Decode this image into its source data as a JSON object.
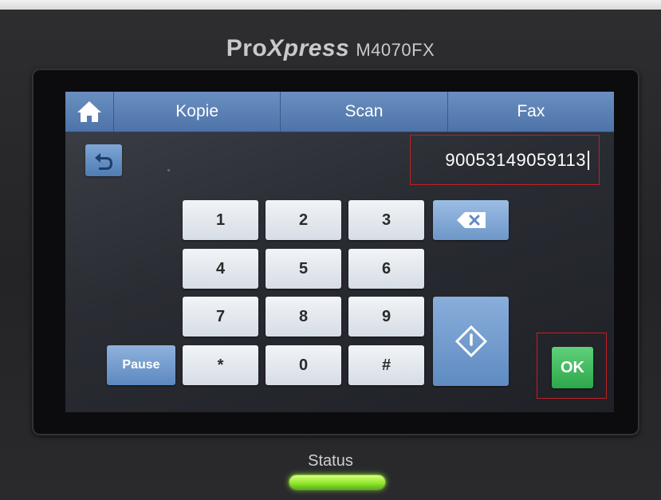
{
  "device": {
    "brand_pro": "Pro",
    "brand_xpress": "Xpress",
    "model": "M4070FX"
  },
  "nav": {
    "home_icon": "home-icon",
    "tabs": [
      {
        "label": "Kopie"
      },
      {
        "label": "Scan"
      },
      {
        "label": "Fax"
      }
    ]
  },
  "number_field": {
    "value": "90053149059113"
  },
  "keypad": {
    "keys": [
      "1",
      "2",
      "3",
      "4",
      "5",
      "6",
      "7",
      "8",
      "9",
      "*",
      "0",
      "#"
    ],
    "pause_label": "Pause",
    "ok_label": "OK",
    "backspace_icon": "backspace-icon",
    "start_icon": "start-icon",
    "back_icon": "back-arrow-icon"
  },
  "status": {
    "label": "Status",
    "led_color": "#8fe62a"
  },
  "colors": {
    "nav_blue": "#5a7fb2",
    "ok_green": "#2da74b",
    "highlight_red": "#c21f22"
  }
}
